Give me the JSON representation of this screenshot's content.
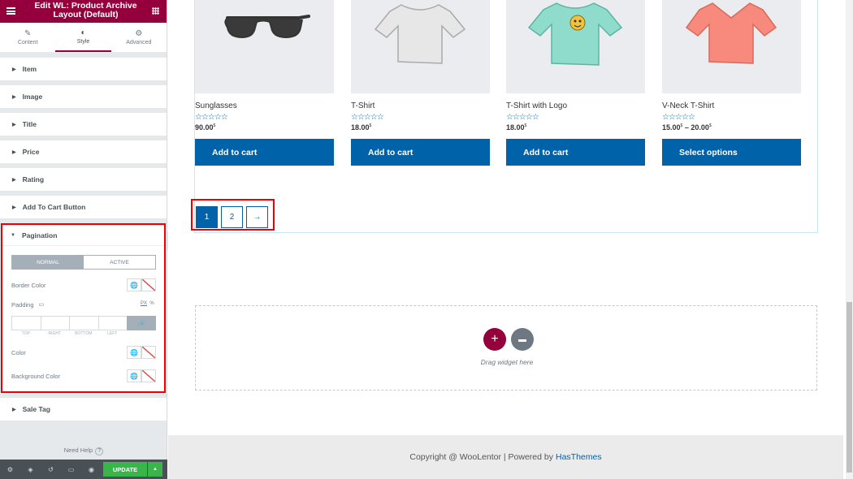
{
  "panel": {
    "title": "Edit WL: Product Archive Layout (Default)",
    "tabs": [
      {
        "label": "Content",
        "icon": "pencil-icon"
      },
      {
        "label": "Style",
        "icon": "half-circle-icon"
      },
      {
        "label": "Advanced",
        "icon": "gear-icon"
      }
    ],
    "sections": [
      "Item",
      "Image",
      "Title",
      "Price",
      "Rating",
      "Add To Cart Button"
    ],
    "pagination": {
      "label": "Pagination",
      "normal": "NORMAL",
      "active": "ACTIVE",
      "border_color": "Border Color",
      "padding": "Padding",
      "unit_px": "PX",
      "unit_pct": "%",
      "pad_labels": [
        "TOP",
        "RIGHT",
        "BOTTOM",
        "LEFT"
      ],
      "color": "Color",
      "bg_color": "Background Color"
    },
    "sale_tag": "Sale Tag",
    "need_help": "Need Help",
    "update": "UPDATE"
  },
  "products": [
    {
      "name": "Sunglasses",
      "stars": "☆☆☆☆☆",
      "price": "90.00",
      "currency": "$",
      "button": "Add to cart",
      "kind": "sunglasses"
    },
    {
      "name": "T-Shirt",
      "stars": "☆☆☆☆☆",
      "price": "18.00",
      "currency": "$",
      "button": "Add to cart",
      "kind": "tshirt-grey"
    },
    {
      "name": "T-Shirt with Logo",
      "stars": "☆☆☆☆☆",
      "price": "18.00",
      "currency": "$",
      "button": "Add to cart",
      "kind": "tshirt-teal"
    },
    {
      "name": "V-Neck T-Shirt",
      "stars": "☆☆☆☆☆",
      "price": "15.00",
      "price_to": "20.00",
      "currency": "$",
      "button": "Select options",
      "kind": "tshirt-coral"
    }
  ],
  "pager": {
    "p1": "1",
    "p2": "2",
    "next": "→"
  },
  "dropzone": {
    "text": "Drag widget here"
  },
  "footer": {
    "text": "Copyright @ WooLentor | Powered by",
    "link": "HasThemes"
  },
  "colors": {
    "brand": "#93003c",
    "accent": "#0063aa",
    "update": "#39b54a"
  }
}
